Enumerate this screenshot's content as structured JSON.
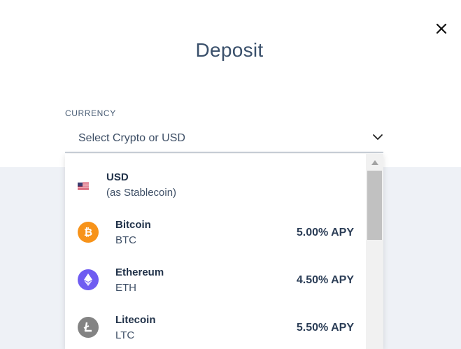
{
  "modal": {
    "title": "Deposit",
    "close_icon": "close-icon"
  },
  "currency": {
    "label": "CURRENCY",
    "placeholder": "Select Crypto or USD",
    "chevron_icon": "chevron-down-icon"
  },
  "options": [
    {
      "name": "USD",
      "sub": "(as Stablecoin)",
      "apy": "",
      "icon": "us-flag-icon"
    },
    {
      "name": "Bitcoin",
      "sub": "BTC",
      "apy": "5.00% APY",
      "icon": "bitcoin-icon",
      "color": "#f7931a"
    },
    {
      "name": "Ethereum",
      "sub": "ETH",
      "apy": "4.50% APY",
      "icon": "ethereum-icon",
      "color": "#6f5cf1"
    },
    {
      "name": "Litecoin",
      "sub": "LTC",
      "apy": "5.50% APY",
      "icon": "litecoin-icon",
      "color": "#838383"
    }
  ],
  "colors": {
    "text": "#2c3e57",
    "background_lower": "#eef1f6"
  }
}
